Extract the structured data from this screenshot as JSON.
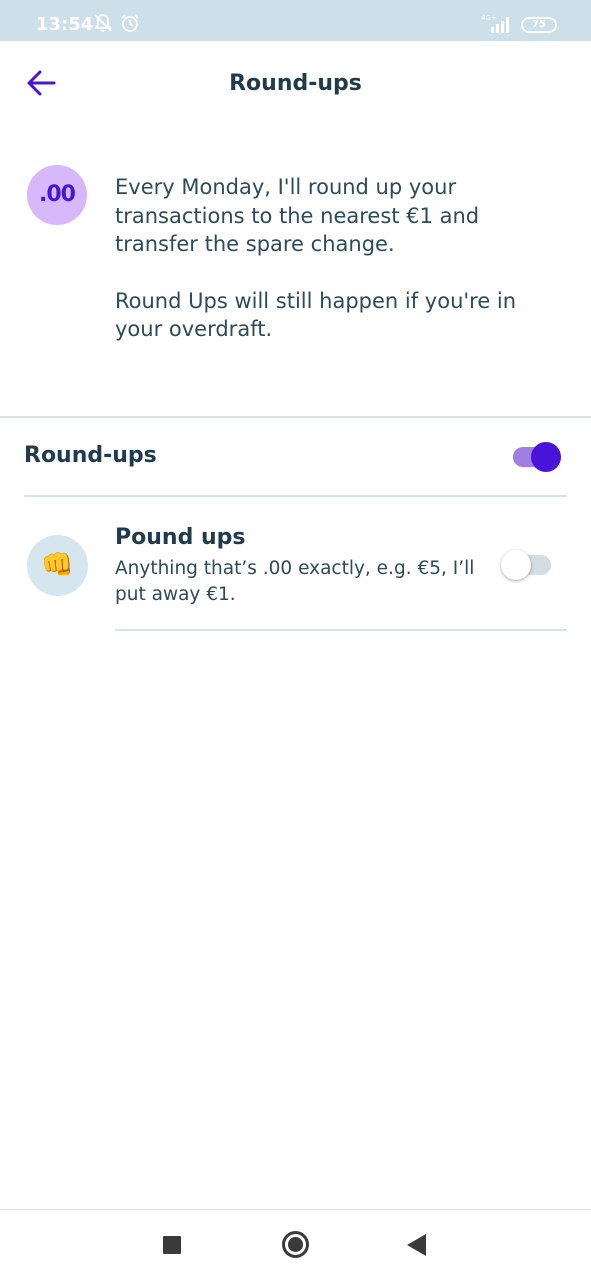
{
  "status_bar": {
    "time": "13:54",
    "network": "4G+",
    "battery": "75",
    "icons": [
      "mute-icon",
      "alarm-icon",
      "signal-icon",
      "battery-icon"
    ]
  },
  "header": {
    "title": "Round-ups",
    "back_icon": "arrow-left-icon"
  },
  "intro": {
    "badge": ".00",
    "paragraph1": "Every Monday, I'll round up your transactions to the nearest €1 and transfer the spare change.",
    "paragraph2": "Round Ups will still happen if you're in your overdraft."
  },
  "roundups_setting": {
    "label": "Round-ups",
    "enabled": true
  },
  "pound_ups_option": {
    "icon": "👊",
    "title": "Pound ups",
    "description": "Anything that’s .00 exactly, e.g. €5, I’ll put away €1.",
    "enabled": false
  },
  "nav_bar": {
    "buttons": [
      "recent-apps-icon",
      "home-icon",
      "back-triangle-icon"
    ]
  },
  "colors": {
    "accent": "#4a14d8",
    "accent_light": "#d6b8fb",
    "status_bar": "#cddfe8",
    "text": "#1f3b4d"
  }
}
